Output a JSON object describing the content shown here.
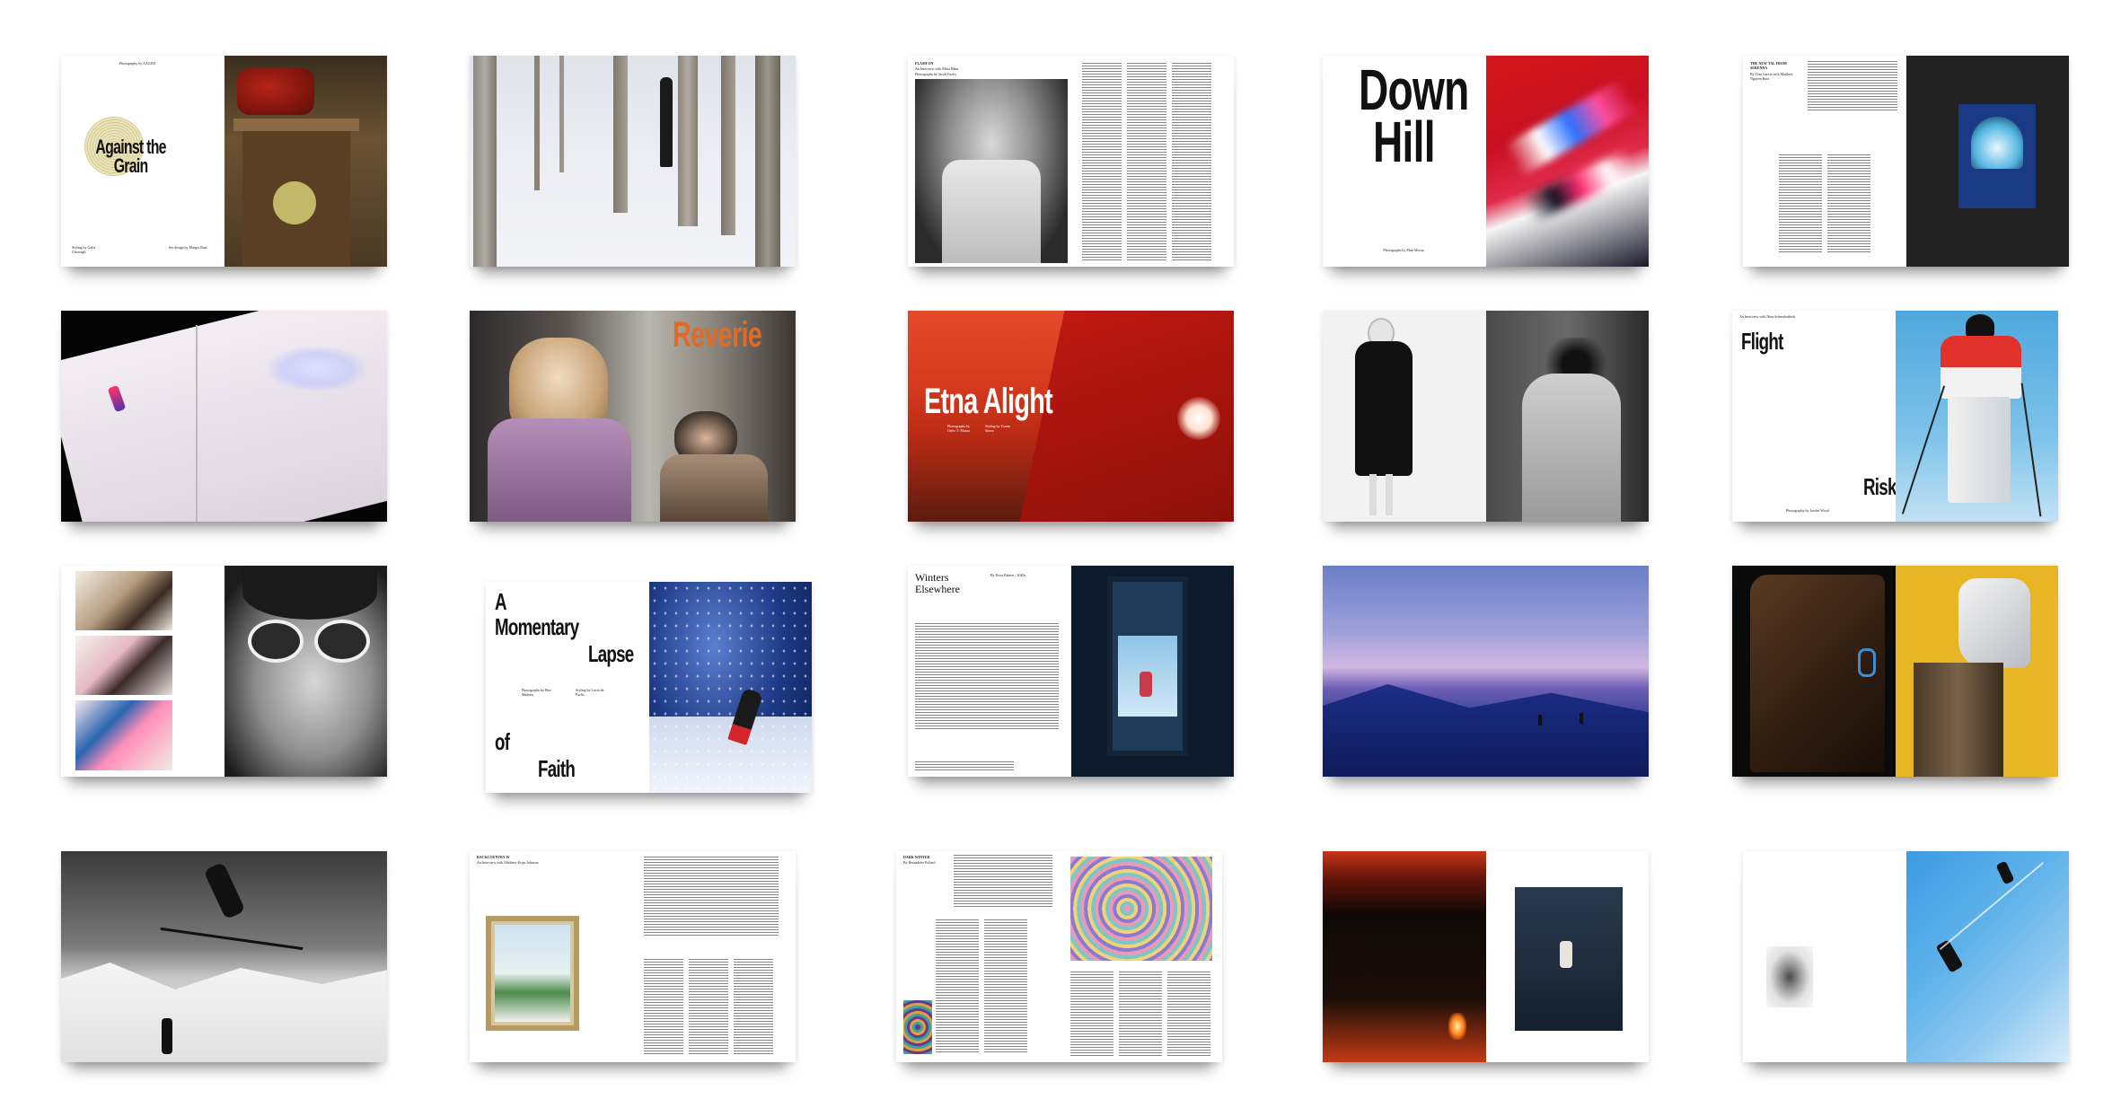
{
  "spreads": [
    {
      "headline": "Against the Grain",
      "credit": "Photography by AAGINI",
      "credit_left": "Styling by Galia Choreagh",
      "credit_right": "Set design by Margot Ruiz"
    },
    {},
    {
      "kicker": "FLASH ON",
      "intro": "An Interview with Mina Hahn",
      "photo_credit": "Photographs by Jacob Farley"
    },
    {
      "headline_line1": "Down",
      "headline_line2": "Hill",
      "credit": "Photographs by Matt Moran"
    },
    {
      "kicker": "THE NEW TAL FROM SERENDA",
      "intro": "By Tom Garcia with Matthew Nguyen Ruiz"
    },
    {},
    {
      "headline": "Reverie"
    },
    {
      "headline": "Etna Alight",
      "credit_left": "Photographs by Orfeo T. Mazza",
      "credit_right": "Styling by Tomas Sierra"
    },
    {},
    {
      "headline_top": "Flight",
      "headline_bottom": "Risk",
      "intro": "An Interview with Nina Schmalenbeck",
      "credit": "Photography by Jacobe Wood"
    },
    {},
    {
      "headline_lines": [
        "A",
        "Momentary",
        "Lapse",
        "of",
        "Faith"
      ],
      "credit_left": "Photographs by Ben Madsen",
      "credit_right": "Styling by Lucia de Fuchs"
    },
    {
      "headline_line1": "Winters",
      "headline_line2": "Elsewhere",
      "byline": "By Erica Palmer / 2020s"
    },
    {},
    {},
    {},
    {
      "kicker": "BACKCOUNTRY IS",
      "intro": "An Interview with Matthew Krips Johnson"
    },
    {
      "kicker": "DARK WINTER",
      "intro": "By Bernadette Pollard"
    },
    {},
    {}
  ]
}
